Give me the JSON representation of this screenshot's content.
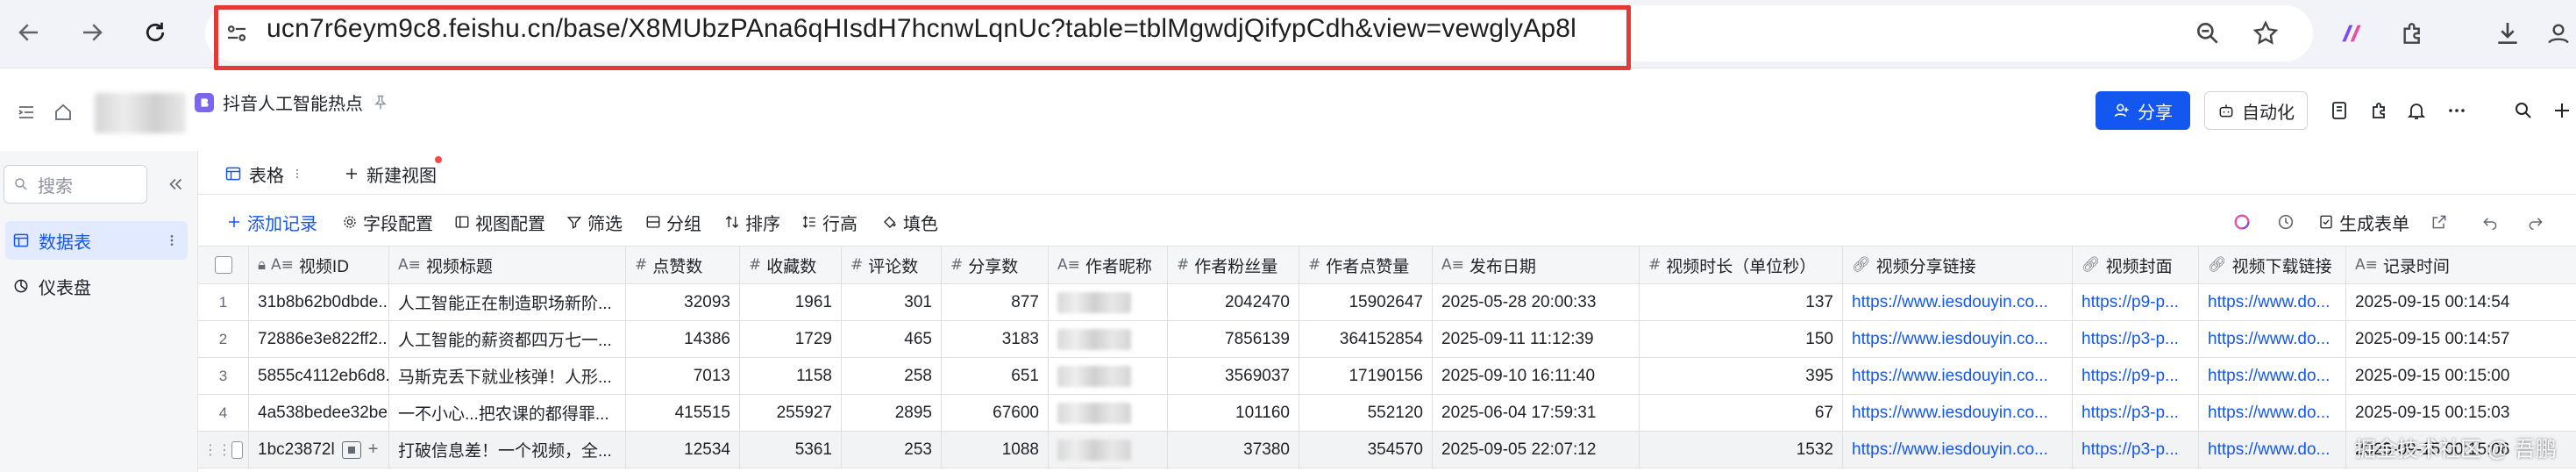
{
  "browser": {
    "url_host": "ucn7r6eym9c8.feishu.cn",
    "url_path": "/base/X8MUbzPAna6qHIsdH7hcnwLqnUc?table=tblMgwdjQifypCdh&view=vewglyAp8l"
  },
  "header": {
    "base_title": "抖音人工智能热点",
    "share_label": "分享",
    "automation_label": "自动化"
  },
  "sidebar": {
    "search_placeholder": "搜索",
    "items": [
      {
        "label": "数据表",
        "active": true
      },
      {
        "label": "仪表盘",
        "active": false
      }
    ]
  },
  "tabs": {
    "table_tab": "表格",
    "new_view": "新建视图"
  },
  "toolbar": {
    "add_record": "添加记录",
    "field_config": "字段配置",
    "view_config": "视图配置",
    "filter": "筛选",
    "group": "分组",
    "sort": "排序",
    "row_height": "行高",
    "fill_color": "填色",
    "generate_form": "生成表单"
  },
  "table": {
    "columns": [
      "视频ID",
      "视频标题",
      "点赞数",
      "收藏数",
      "评论数",
      "分享数",
      "作者昵称",
      "作者粉丝量",
      "作者点赞量",
      "发布日期",
      "视频时长（单位秒）",
      "视频分享链接",
      "视频封面",
      "视频下载链接",
      "记录时间"
    ],
    "rows": [
      {
        "index": "1",
        "cells": [
          "31b8b62b0dbde...",
          "人工智能正在制造职场新阶...",
          "32093",
          "1961",
          "301",
          "877",
          "",
          "2042470",
          "15902647",
          "2025-05-28 20:00:33",
          "137",
          "https://www.iesdouyin.co...",
          "https://p9-p...",
          "https://www.do...",
          "2025-09-15 00:14:54"
        ]
      },
      {
        "index": "2",
        "cells": [
          "72886e3e822ff2...",
          "人工智能的薪资都四万七一...",
          "14386",
          "1729",
          "465",
          "3183",
          "",
          "7856139",
          "364152854",
          "2025-09-11 11:12:39",
          "150",
          "https://www.iesdouyin.co...",
          "https://p3-p...",
          "https://www.do...",
          "2025-09-15 00:14:57"
        ]
      },
      {
        "index": "3",
        "cells": [
          "5855c4112eb6d8...",
          "马斯克丢下就业核弹！人形...",
          "7013",
          "1158",
          "258",
          "651",
          "",
          "3569037",
          "17190156",
          "2025-09-10 16:11:40",
          "395",
          "https://www.iesdouyin.co...",
          "https://p9-p...",
          "https://www.do...",
          "2025-09-15 00:15:00"
        ]
      },
      {
        "index": "4",
        "cells": [
          "4a538bedee32be...",
          "一不小心...把农课的都得罪...",
          "415515",
          "255927",
          "2895",
          "67600",
          "",
          "101160",
          "552120",
          "2025-06-04 17:59:31",
          "67",
          "https://www.iesdouyin.co...",
          "https://p3-p...",
          "https://www.do...",
          "2025-09-15 00:15:03"
        ]
      },
      {
        "index": "",
        "cells": [
          "1bc23872l",
          "打破信息差！一个视频，全...",
          "12534",
          "5361",
          "253",
          "1088",
          "",
          "37380",
          "354570",
          "2025-09-05 22:07:12",
          "1532",
          "https://www.iesdouyin.co...",
          "https://p3-p...",
          "https://www.do...",
          "2025-09-15 00:15:06"
        ]
      }
    ]
  },
  "watermark": "掘金技术社区 @ 吾鹏"
}
